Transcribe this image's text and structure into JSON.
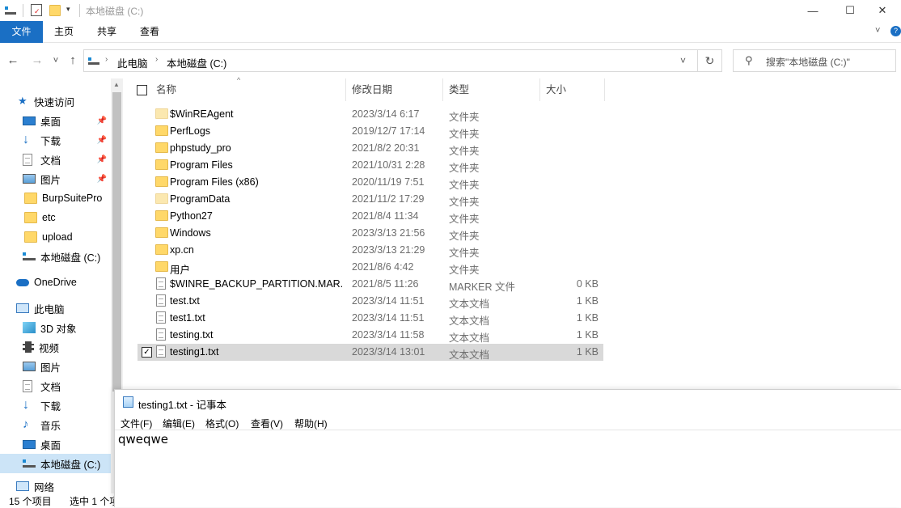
{
  "window": {
    "title": "本地磁盘 (C:)",
    "minimize": "—",
    "maximize": "☐",
    "close": "✕"
  },
  "ribbon": {
    "tabs": [
      {
        "label": "文件"
      },
      {
        "label": "主页"
      },
      {
        "label": "共享"
      },
      {
        "label": "查看"
      }
    ]
  },
  "nav": {
    "back": "←",
    "forward": "→",
    "recent": "˅",
    "up": "↑"
  },
  "address": {
    "crumbs": [
      "此电脑",
      "本地磁盘 (C:)"
    ],
    "dropdown": "˅",
    "refresh": "↻"
  },
  "search": {
    "placeholder": "搜索\"本地磁盘 (C:)\""
  },
  "sidebar": {
    "items": [
      {
        "label": "快速访问",
        "icon": "star-icon"
      },
      {
        "label": "桌面",
        "icon": "desktop-icon",
        "pinned": true
      },
      {
        "label": "下载",
        "icon": "download-icon",
        "pinned": true
      },
      {
        "label": "文档",
        "icon": "document-icon",
        "pinned": true
      },
      {
        "label": "图片",
        "icon": "pictures-icon",
        "pinned": true
      },
      {
        "label": "BurpSuitePro",
        "icon": "folder-icon"
      },
      {
        "label": "etc",
        "icon": "folder-icon"
      },
      {
        "label": "upload",
        "icon": "folder-icon"
      },
      {
        "label": "本地磁盘 (C:)",
        "icon": "drive-icon"
      },
      {
        "label": "OneDrive",
        "icon": "cloud-icon"
      },
      {
        "label": "此电脑",
        "icon": "computer-icon"
      },
      {
        "label": "3D 对象",
        "icon": "3d-objects-icon"
      },
      {
        "label": "视频",
        "icon": "video-icon"
      },
      {
        "label": "图片",
        "icon": "pictures-icon"
      },
      {
        "label": "文档",
        "icon": "document-icon"
      },
      {
        "label": "下载",
        "icon": "download-icon"
      },
      {
        "label": "音乐",
        "icon": "music-icon"
      },
      {
        "label": "桌面",
        "icon": "desktop-icon"
      },
      {
        "label": "本地磁盘 (C:)",
        "icon": "drive-icon"
      },
      {
        "label": "网络",
        "icon": "network-icon"
      }
    ]
  },
  "table": {
    "columns": {
      "name": "名称",
      "date": "修改日期",
      "type": "类型",
      "size": "大小"
    },
    "rows": [
      {
        "name": "$WinREAgent",
        "date": "2023/3/14 6:17",
        "type": "文件夹",
        "size": "",
        "kind": "folder-pale"
      },
      {
        "name": "PerfLogs",
        "date": "2019/12/7 17:14",
        "type": "文件夹",
        "size": "",
        "kind": "folder"
      },
      {
        "name": "phpstudy_pro",
        "date": "2021/8/2 20:31",
        "type": "文件夹",
        "size": "",
        "kind": "folder"
      },
      {
        "name": "Program Files",
        "date": "2021/10/31 2:28",
        "type": "文件夹",
        "size": "",
        "kind": "folder"
      },
      {
        "name": "Program Files (x86)",
        "date": "2020/11/19 7:51",
        "type": "文件夹",
        "size": "",
        "kind": "folder"
      },
      {
        "name": "ProgramData",
        "date": "2021/11/2 17:29",
        "type": "文件夹",
        "size": "",
        "kind": "folder-pale"
      },
      {
        "name": "Python27",
        "date": "2021/8/4 11:34",
        "type": "文件夹",
        "size": "",
        "kind": "folder"
      },
      {
        "name": "Windows",
        "date": "2023/3/13 21:56",
        "type": "文件夹",
        "size": "",
        "kind": "folder"
      },
      {
        "name": "xp.cn",
        "date": "2023/3/13 21:29",
        "type": "文件夹",
        "size": "",
        "kind": "folder"
      },
      {
        "name": "用户",
        "date": "2021/8/6 4:42",
        "type": "文件夹",
        "size": "",
        "kind": "folder"
      },
      {
        "name": "$WINRE_BACKUP_PARTITION.MAR...",
        "date": "2021/8/5 11:26",
        "type": "MARKER 文件",
        "size": "0 KB",
        "kind": "doc"
      },
      {
        "name": "test.txt",
        "date": "2023/3/14 11:51",
        "type": "文本文档",
        "size": "1 KB",
        "kind": "doc"
      },
      {
        "name": "test1.txt",
        "date": "2023/3/14 11:51",
        "type": "文本文档",
        "size": "1 KB",
        "kind": "doc"
      },
      {
        "name": "testing.txt",
        "date": "2023/3/14 11:58",
        "type": "文本文档",
        "size": "1 KB",
        "kind": "doc"
      },
      {
        "name": "testing1.txt",
        "date": "2023/3/14 13:01",
        "type": "文本文档",
        "size": "1 KB",
        "kind": "doc",
        "selected": true
      }
    ]
  },
  "status": {
    "count": "15 个项目",
    "selected": "选中 1 个项"
  },
  "notepad": {
    "title": "testing1.txt - 记事本",
    "menu": [
      "文件(F)",
      "编辑(E)",
      "格式(O)",
      "查看(V)",
      "帮助(H)"
    ],
    "content": "qweqwe"
  },
  "colors": {
    "accent": "#1a6fc4",
    "selection": "#cce4f7",
    "row_selected": "#d9d9d9"
  }
}
